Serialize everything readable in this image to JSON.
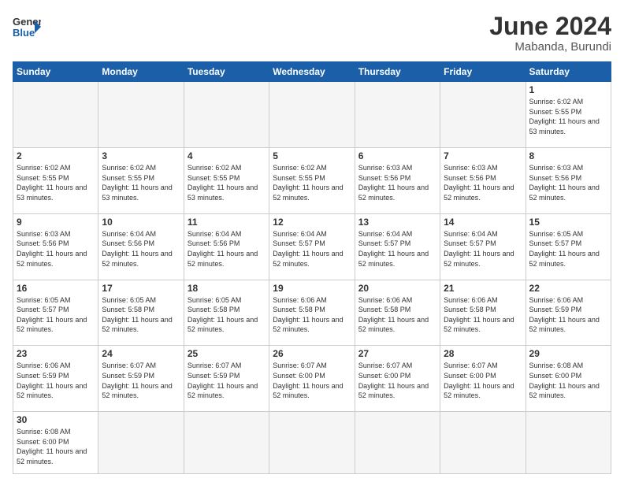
{
  "header": {
    "logo_general": "General",
    "logo_blue": "Blue",
    "title": "June 2024",
    "location": "Mabanda, Burundi"
  },
  "days_of_week": [
    "Sunday",
    "Monday",
    "Tuesday",
    "Wednesday",
    "Thursday",
    "Friday",
    "Saturday"
  ],
  "weeks": [
    [
      {
        "day": null,
        "empty": true
      },
      {
        "day": null,
        "empty": true
      },
      {
        "day": null,
        "empty": true
      },
      {
        "day": null,
        "empty": true
      },
      {
        "day": null,
        "empty": true
      },
      {
        "day": null,
        "empty": true
      },
      {
        "day": 1,
        "sunrise": "6:02 AM",
        "sunset": "5:55 PM",
        "daylight": "11 hours and 53 minutes."
      }
    ],
    [
      {
        "day": 2,
        "sunrise": "6:02 AM",
        "sunset": "5:55 PM",
        "daylight": "11 hours and 53 minutes."
      },
      {
        "day": 3,
        "sunrise": "6:02 AM",
        "sunset": "5:55 PM",
        "daylight": "11 hours and 53 minutes."
      },
      {
        "day": 4,
        "sunrise": "6:02 AM",
        "sunset": "5:55 PM",
        "daylight": "11 hours and 53 minutes."
      },
      {
        "day": 5,
        "sunrise": "6:02 AM",
        "sunset": "5:55 PM",
        "daylight": "11 hours and 52 minutes."
      },
      {
        "day": 6,
        "sunrise": "6:03 AM",
        "sunset": "5:56 PM",
        "daylight": "11 hours and 52 minutes."
      },
      {
        "day": 7,
        "sunrise": "6:03 AM",
        "sunset": "5:56 PM",
        "daylight": "11 hours and 52 minutes."
      },
      {
        "day": 8,
        "sunrise": "6:03 AM",
        "sunset": "5:56 PM",
        "daylight": "11 hours and 52 minutes."
      }
    ],
    [
      {
        "day": 9,
        "sunrise": "6:03 AM",
        "sunset": "5:56 PM",
        "daylight": "11 hours and 52 minutes."
      },
      {
        "day": 10,
        "sunrise": "6:04 AM",
        "sunset": "5:56 PM",
        "daylight": "11 hours and 52 minutes."
      },
      {
        "day": 11,
        "sunrise": "6:04 AM",
        "sunset": "5:56 PM",
        "daylight": "11 hours and 52 minutes."
      },
      {
        "day": 12,
        "sunrise": "6:04 AM",
        "sunset": "5:57 PM",
        "daylight": "11 hours and 52 minutes."
      },
      {
        "day": 13,
        "sunrise": "6:04 AM",
        "sunset": "5:57 PM",
        "daylight": "11 hours and 52 minutes."
      },
      {
        "day": 14,
        "sunrise": "6:04 AM",
        "sunset": "5:57 PM",
        "daylight": "11 hours and 52 minutes."
      },
      {
        "day": 15,
        "sunrise": "6:05 AM",
        "sunset": "5:57 PM",
        "daylight": "11 hours and 52 minutes."
      }
    ],
    [
      {
        "day": 16,
        "sunrise": "6:05 AM",
        "sunset": "5:57 PM",
        "daylight": "11 hours and 52 minutes."
      },
      {
        "day": 17,
        "sunrise": "6:05 AM",
        "sunset": "5:58 PM",
        "daylight": "11 hours and 52 minutes."
      },
      {
        "day": 18,
        "sunrise": "6:05 AM",
        "sunset": "5:58 PM",
        "daylight": "11 hours and 52 minutes."
      },
      {
        "day": 19,
        "sunrise": "6:06 AM",
        "sunset": "5:58 PM",
        "daylight": "11 hours and 52 minutes."
      },
      {
        "day": 20,
        "sunrise": "6:06 AM",
        "sunset": "5:58 PM",
        "daylight": "11 hours and 52 minutes."
      },
      {
        "day": 21,
        "sunrise": "6:06 AM",
        "sunset": "5:58 PM",
        "daylight": "11 hours and 52 minutes."
      },
      {
        "day": 22,
        "sunrise": "6:06 AM",
        "sunset": "5:59 PM",
        "daylight": "11 hours and 52 minutes."
      }
    ],
    [
      {
        "day": 23,
        "sunrise": "6:06 AM",
        "sunset": "5:59 PM",
        "daylight": "11 hours and 52 minutes."
      },
      {
        "day": 24,
        "sunrise": "6:07 AM",
        "sunset": "5:59 PM",
        "daylight": "11 hours and 52 minutes."
      },
      {
        "day": 25,
        "sunrise": "6:07 AM",
        "sunset": "5:59 PM",
        "daylight": "11 hours and 52 minutes."
      },
      {
        "day": 26,
        "sunrise": "6:07 AM",
        "sunset": "6:00 PM",
        "daylight": "11 hours and 52 minutes."
      },
      {
        "day": 27,
        "sunrise": "6:07 AM",
        "sunset": "6:00 PM",
        "daylight": "11 hours and 52 minutes."
      },
      {
        "day": 28,
        "sunrise": "6:07 AM",
        "sunset": "6:00 PM",
        "daylight": "11 hours and 52 minutes."
      },
      {
        "day": 29,
        "sunrise": "6:08 AM",
        "sunset": "6:00 PM",
        "daylight": "11 hours and 52 minutes."
      }
    ],
    [
      {
        "day": 30,
        "sunrise": "6:08 AM",
        "sunset": "6:00 PM",
        "daylight": "11 hours and 52 minutes."
      },
      {
        "day": null,
        "empty": true
      },
      {
        "day": null,
        "empty": true
      },
      {
        "day": null,
        "empty": true
      },
      {
        "day": null,
        "empty": true
      },
      {
        "day": null,
        "empty": true
      },
      {
        "day": null,
        "empty": true
      }
    ]
  ]
}
